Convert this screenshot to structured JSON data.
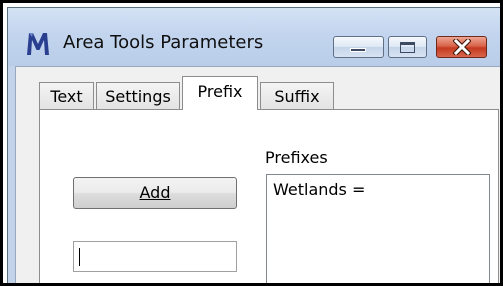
{
  "window": {
    "title": "Area Tools Parameters",
    "icon": "microstation-m-icon",
    "controls": [
      "minimize",
      "maximize",
      "close"
    ]
  },
  "tabs": [
    {
      "label": "Text",
      "active": false
    },
    {
      "label": "Settings",
      "active": false
    },
    {
      "label": "Prefix",
      "active": true
    },
    {
      "label": "Suffix",
      "active": false
    }
  ],
  "prefix_panel": {
    "add_button_label": "Add",
    "add_button_mnemonic": "A",
    "input_value": "",
    "list_label": "Prefixes",
    "list_items": [
      "Wetlands ="
    ]
  },
  "colors": {
    "titlebar": "#c3d5ee",
    "close_button": "#c4391f",
    "panel_background": "#ffffff",
    "client_background": "#f0f0f0"
  }
}
